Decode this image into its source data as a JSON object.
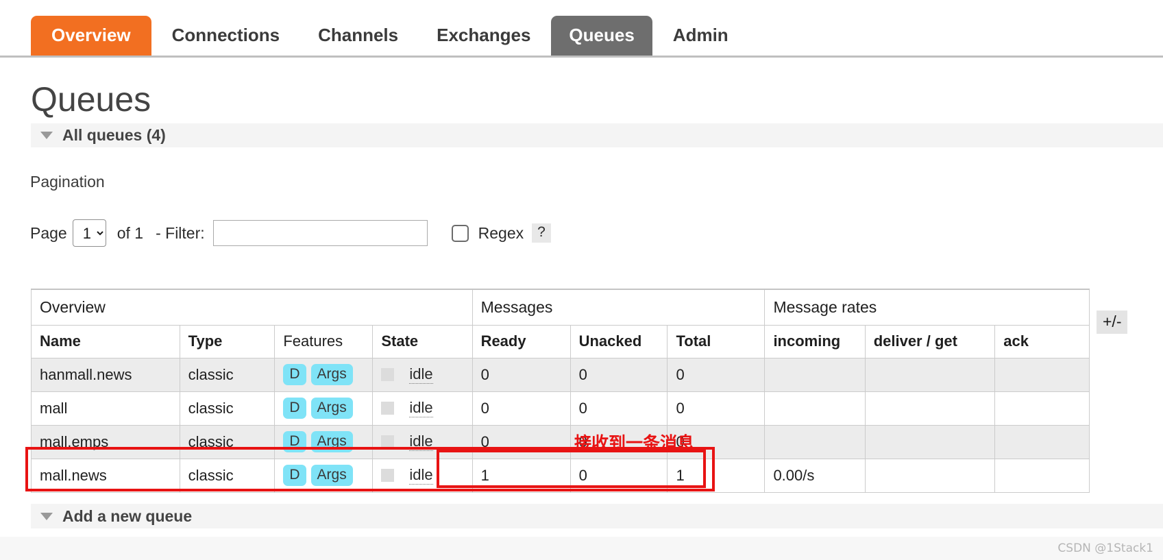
{
  "nav": {
    "tabs": [
      {
        "label": "Overview",
        "state": "brand"
      },
      {
        "label": "Connections",
        "state": "normal"
      },
      {
        "label": "Channels",
        "state": "normal"
      },
      {
        "label": "Exchanges",
        "state": "normal"
      },
      {
        "label": "Queues",
        "state": "active"
      },
      {
        "label": "Admin",
        "state": "normal"
      }
    ]
  },
  "page": {
    "title": "Queues",
    "section_title": "All queues (4)",
    "bottom_section_title": "Add a new queue",
    "watermark": "CSDN @1Stack1"
  },
  "pagination": {
    "label": "Pagination",
    "page_word": "Page",
    "page_value": "1",
    "page_options": [
      "1"
    ],
    "of_text": "of 1",
    "filter_label": "- Filter:",
    "filter_value": "",
    "filter_placeholder": "",
    "regex_label": "Regex",
    "regex_checked": false,
    "help_label": "?"
  },
  "table": {
    "group_headers": [
      "Overview",
      "Messages",
      "Message rates"
    ],
    "columns": [
      {
        "label": "Name",
        "bold": true
      },
      {
        "label": "Type",
        "bold": true
      },
      {
        "label": "Features",
        "bold": false
      },
      {
        "label": "State",
        "bold": true
      },
      {
        "label": "Ready",
        "bold": true
      },
      {
        "label": "Unacked",
        "bold": true
      },
      {
        "label": "Total",
        "bold": true
      },
      {
        "label": "incoming",
        "bold": true
      },
      {
        "label": "deliver / get",
        "bold": true
      },
      {
        "label": "ack",
        "bold": true
      }
    ],
    "rows": [
      {
        "name": "hanmall.news",
        "type": "classic",
        "features": [
          "D",
          "Args"
        ],
        "state": "idle",
        "ready": "0",
        "unacked": "0",
        "total": "0",
        "incoming": "",
        "deliver_get": "",
        "ack": ""
      },
      {
        "name": "mall",
        "type": "classic",
        "features": [
          "D",
          "Args"
        ],
        "state": "idle",
        "ready": "0",
        "unacked": "0",
        "total": "0",
        "incoming": "",
        "deliver_get": "",
        "ack": ""
      },
      {
        "name": "mall.emps",
        "type": "classic",
        "features": [
          "D",
          "Args"
        ],
        "state": "idle",
        "ready": "0",
        "unacked": "0",
        "total": "0",
        "incoming": "",
        "deliver_get": "",
        "ack": ""
      },
      {
        "name": "mall.news",
        "type": "classic",
        "features": [
          "D",
          "Args"
        ],
        "state": "idle",
        "ready": "1",
        "unacked": "0",
        "total": "1",
        "incoming": "0.00/s",
        "deliver_get": "",
        "ack": ""
      }
    ],
    "columns_toggle_label": "+/-"
  },
  "annotation": {
    "text": "接收到一条消息",
    "color": "#e81313"
  },
  "colors": {
    "brand_orange": "#f26f21",
    "active_tab_gray": "#6e6e6e",
    "badge_cyan": "#7fe3f7",
    "annotation_red": "#e81313"
  }
}
